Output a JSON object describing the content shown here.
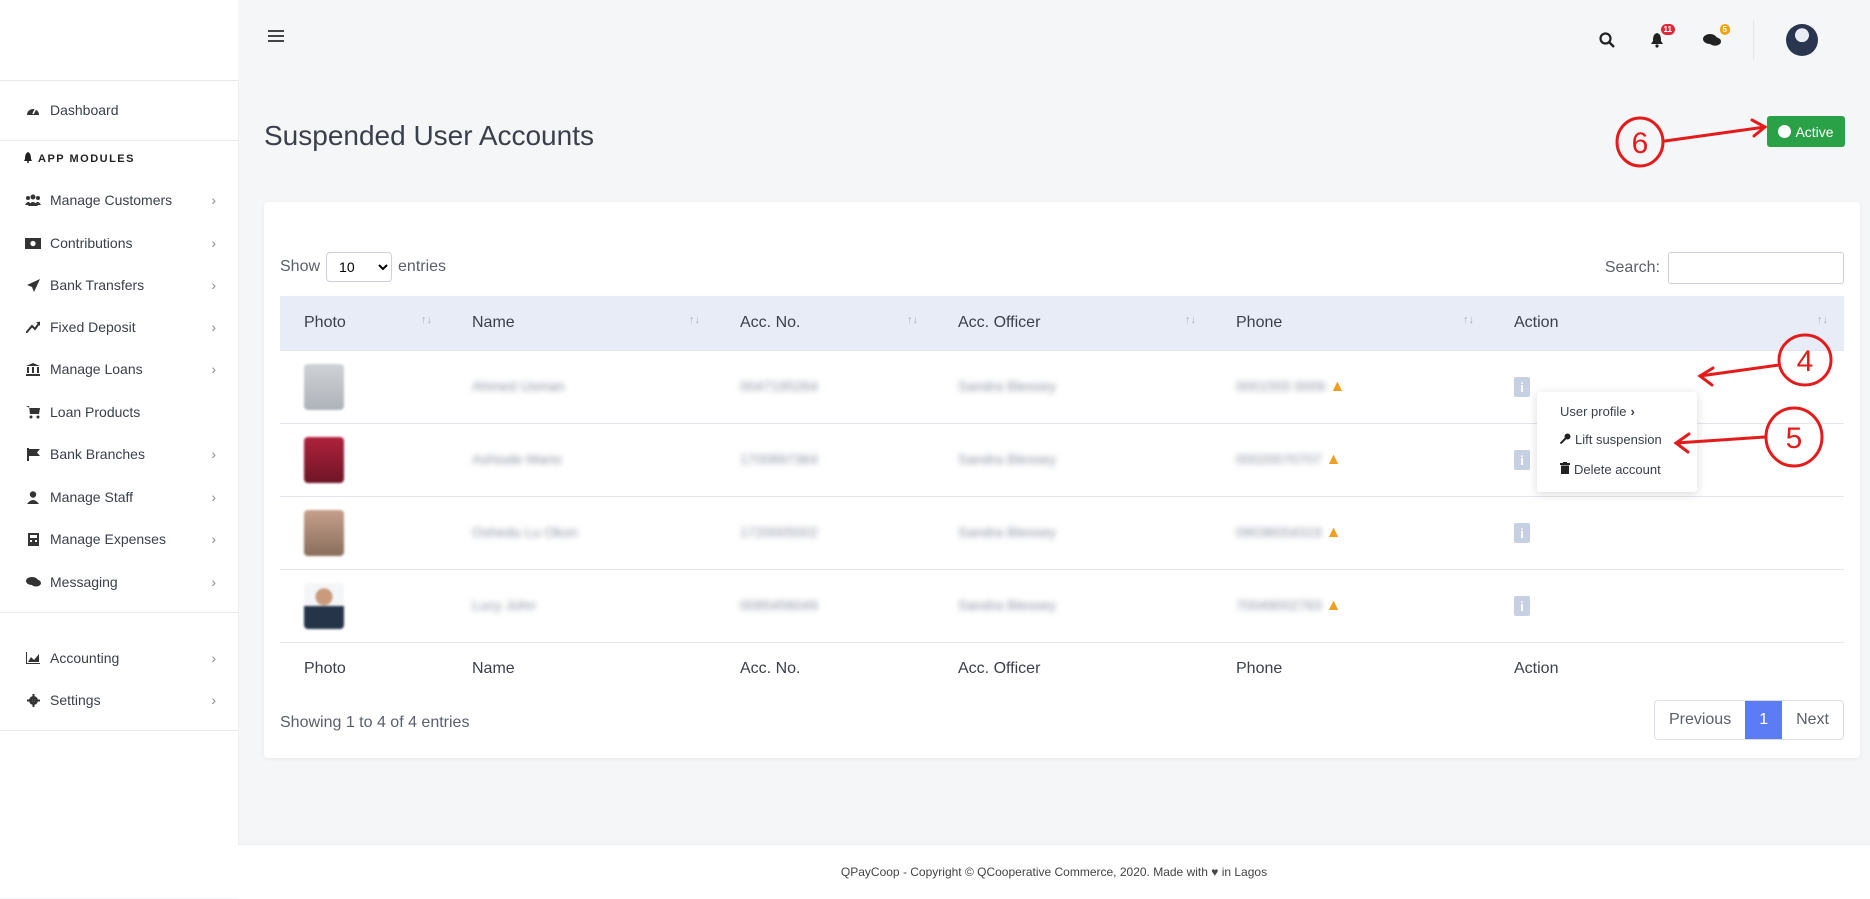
{
  "sidebar": {
    "dashboard": "Dashboard",
    "section": "APP MODULES",
    "items": [
      {
        "label": "Manage Customers",
        "icon": "users-icon"
      },
      {
        "label": "Contributions",
        "icon": "money-icon"
      },
      {
        "label": "Bank Transfers",
        "icon": "send-icon"
      },
      {
        "label": "Fixed Deposit",
        "icon": "trend-icon"
      },
      {
        "label": "Manage Loans",
        "icon": "bank-icon"
      },
      {
        "label": "Loan Products",
        "icon": "cart-icon"
      },
      {
        "label": "Bank Branches",
        "icon": "flag-icon"
      },
      {
        "label": "Manage Staff",
        "icon": "user-icon"
      },
      {
        "label": "Manage Expenses",
        "icon": "calculator-icon"
      },
      {
        "label": "Messaging",
        "icon": "chat-icon"
      }
    ],
    "bottom": [
      {
        "label": "Accounting",
        "icon": "chart-icon"
      },
      {
        "label": "Settings",
        "icon": "gear-icon"
      }
    ]
  },
  "topbar": {
    "notif_count": "11",
    "msg_count": "5"
  },
  "page": {
    "title": "Suspended User Accounts",
    "status": "Active",
    "status_color": "#2aa146"
  },
  "table": {
    "show_label": "Show",
    "entries_label": "entries",
    "page_length": "10",
    "search_label": "Search:",
    "columns": [
      "Photo",
      "Name",
      "Acc. No.",
      "Acc. Officer",
      "Phone",
      "Action"
    ],
    "rows": [
      {
        "name": "Ahmed Usman",
        "acc": "0047195264",
        "officer": "Sandra Blessey",
        "phone": "0001555 0009"
      },
      {
        "name": "Ashiode Mario",
        "acc": "1700897364",
        "officer": "Sandra Blessey",
        "phone": "00020070707"
      },
      {
        "name": "Oshedu Lu Okon",
        "acc": "1720005002",
        "officer": "Sandra Blessey",
        "phone": "09036054319"
      },
      {
        "name": "Lucy John",
        "acc": "0085456049",
        "officer": "Sandra Blessey",
        "phone": "70049002763"
      }
    ],
    "showing": "Showing 1 to 4 of 4 entries",
    "pager": {
      "prev": "Previous",
      "current": "1",
      "next": "Next"
    }
  },
  "dropdown": {
    "profile": "User profile",
    "lift": "Lift suspension",
    "delete": "Delete account"
  },
  "footer": "QPayCoop - Copyright © QCooperative Commerce, 2020. Made with ♥ in Lagos",
  "annotations": {
    "a4": "4",
    "a5": "5",
    "a6": "6"
  }
}
